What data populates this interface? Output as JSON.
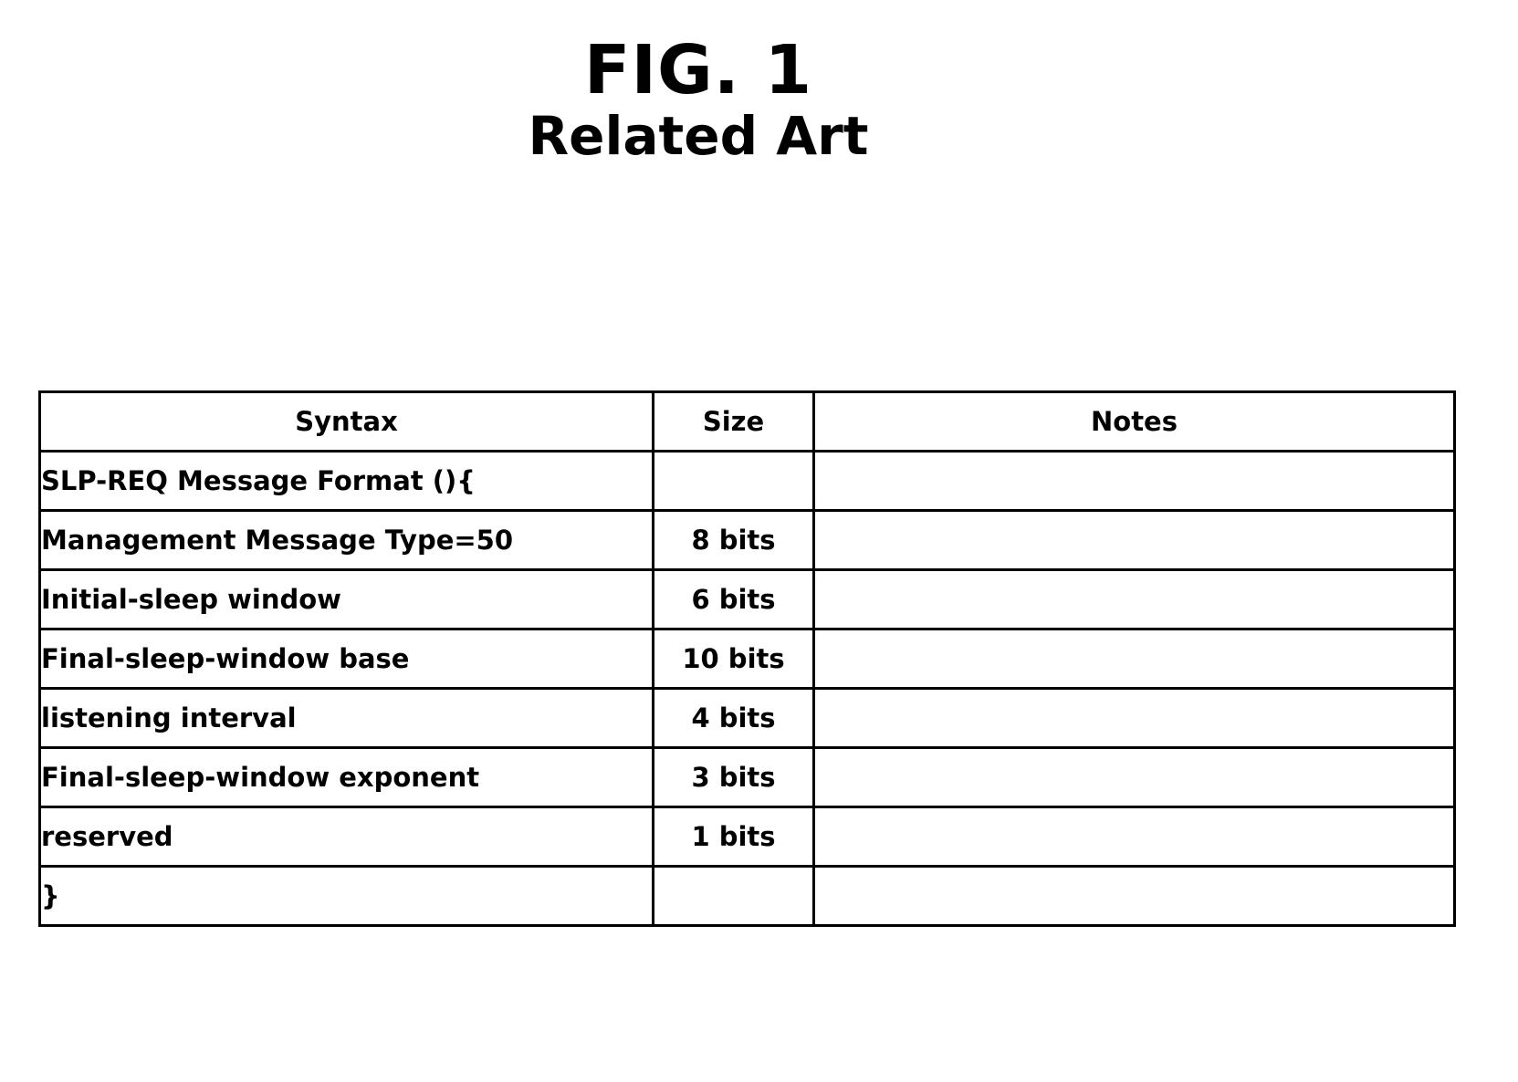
{
  "figure": {
    "number": "FIG. 1",
    "subtitle": "Related Art"
  },
  "table": {
    "headers": {
      "syntax": "Syntax",
      "size": "Size",
      "notes": "Notes"
    },
    "rows": [
      {
        "syntax": "SLP-REQ Message Format (){",
        "size": "",
        "notes": ""
      },
      {
        "syntax": "Management Message Type=50",
        "size": "8 bits",
        "notes": ""
      },
      {
        "syntax": "Initial-sleep window",
        "size": "6 bits",
        "notes": ""
      },
      {
        "syntax": "Final-sleep-window base",
        "size": "10 bits",
        "notes": ""
      },
      {
        "syntax": "listening interval",
        "size": "4 bits",
        "notes": ""
      },
      {
        "syntax": "Final-sleep-window exponent",
        "size": "3 bits",
        "notes": ""
      },
      {
        "syntax": "reserved",
        "size": "1 bits",
        "notes": ""
      },
      {
        "syntax": "}",
        "size": "",
        "notes": ""
      }
    ]
  },
  "colors": {
    "ink": "#000000",
    "page": "#ffffff"
  }
}
